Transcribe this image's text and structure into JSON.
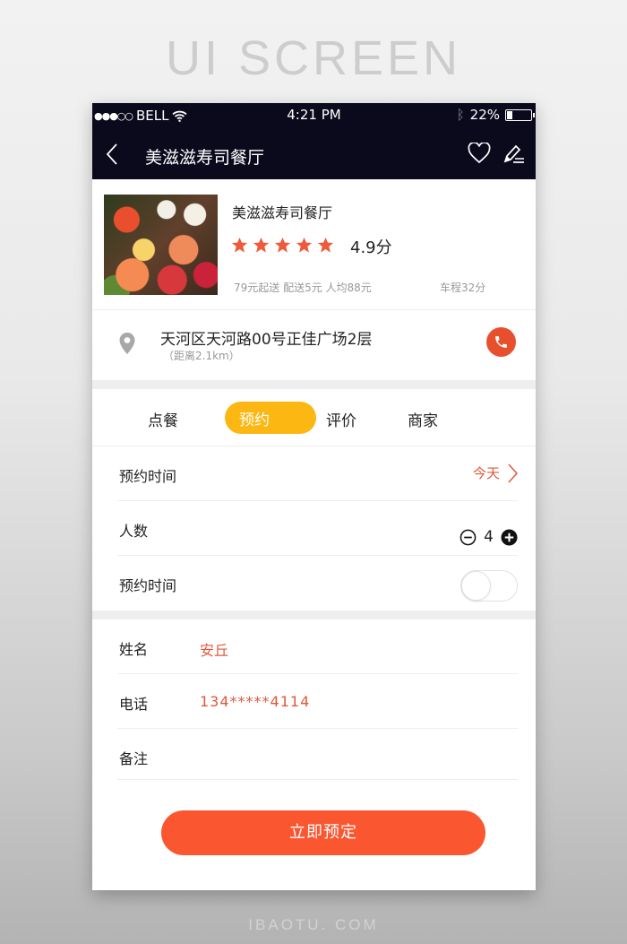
{
  "page": {
    "banner_title": "UI SCREEN",
    "footer_brand": "IBAOTU. COM"
  },
  "status_bar": {
    "signal": "●●●○○",
    "carrier": "BELL",
    "wifi_icon": "wifi-icon",
    "time": "4:21 PM",
    "bluetooth_icon": "bluetooth-icon",
    "battery_percent": "22%",
    "battery_level": 0.22
  },
  "nav": {
    "back_icon": "chevron-left-icon",
    "title": "美滋滋寿司餐厅",
    "favorite_icon": "heart-icon",
    "edit_icon": "pencil-icon"
  },
  "restaurant": {
    "name": "美滋滋寿司餐厅",
    "stars": 5,
    "rating": "4.9分",
    "meta": "79元起送 配送5元 人均88元",
    "drive_time": "车程32分",
    "address": "天河区天河路00号正佳广场2层",
    "distance": "（距离2.1km）",
    "call_icon": "phone-icon",
    "location_icon": "map-pin-icon"
  },
  "tabs": [
    {
      "label": "点餐",
      "active": false
    },
    {
      "label": "预约",
      "active": true
    },
    {
      "label": "评价",
      "active": false
    },
    {
      "label": "商家",
      "active": false
    }
  ],
  "reservation": {
    "time_label": "预约时间",
    "time_value": "今天",
    "people_label": "人数",
    "people_count": "4",
    "toggle_label": "预约时间",
    "toggle_on": false
  },
  "contact": {
    "name_label": "姓名",
    "name_value": "安丘",
    "phone_label": "电话",
    "phone_value": "134*****4114",
    "note_label": "备注",
    "note_value": ""
  },
  "cta": {
    "label": "立即预定"
  },
  "colors": {
    "accent_orange": "#fa5630",
    "tab_yellow": "#fcb712",
    "value_red": "#e0583a",
    "header_dark": "#0b0a1d"
  }
}
